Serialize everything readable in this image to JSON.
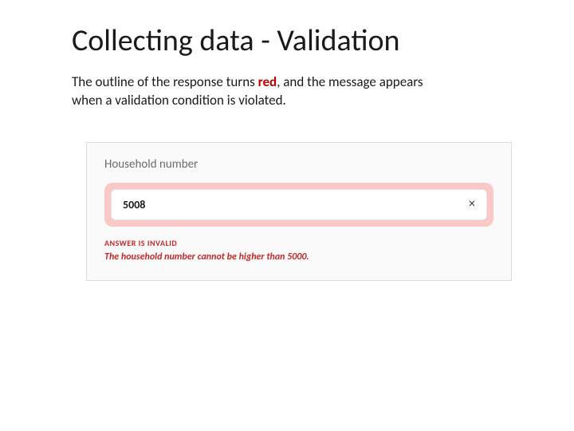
{
  "title": "Collecting data - Validation",
  "description": {
    "pre": "The outline of the response turns ",
    "highlight": "red",
    "post": ", and the message appears when a validation condition is violated."
  },
  "form": {
    "field_label": "Household number",
    "input_value": "5008",
    "error_heading": "ANSWER IS INVALID",
    "error_message": "The household number cannot be higher than 5000."
  }
}
